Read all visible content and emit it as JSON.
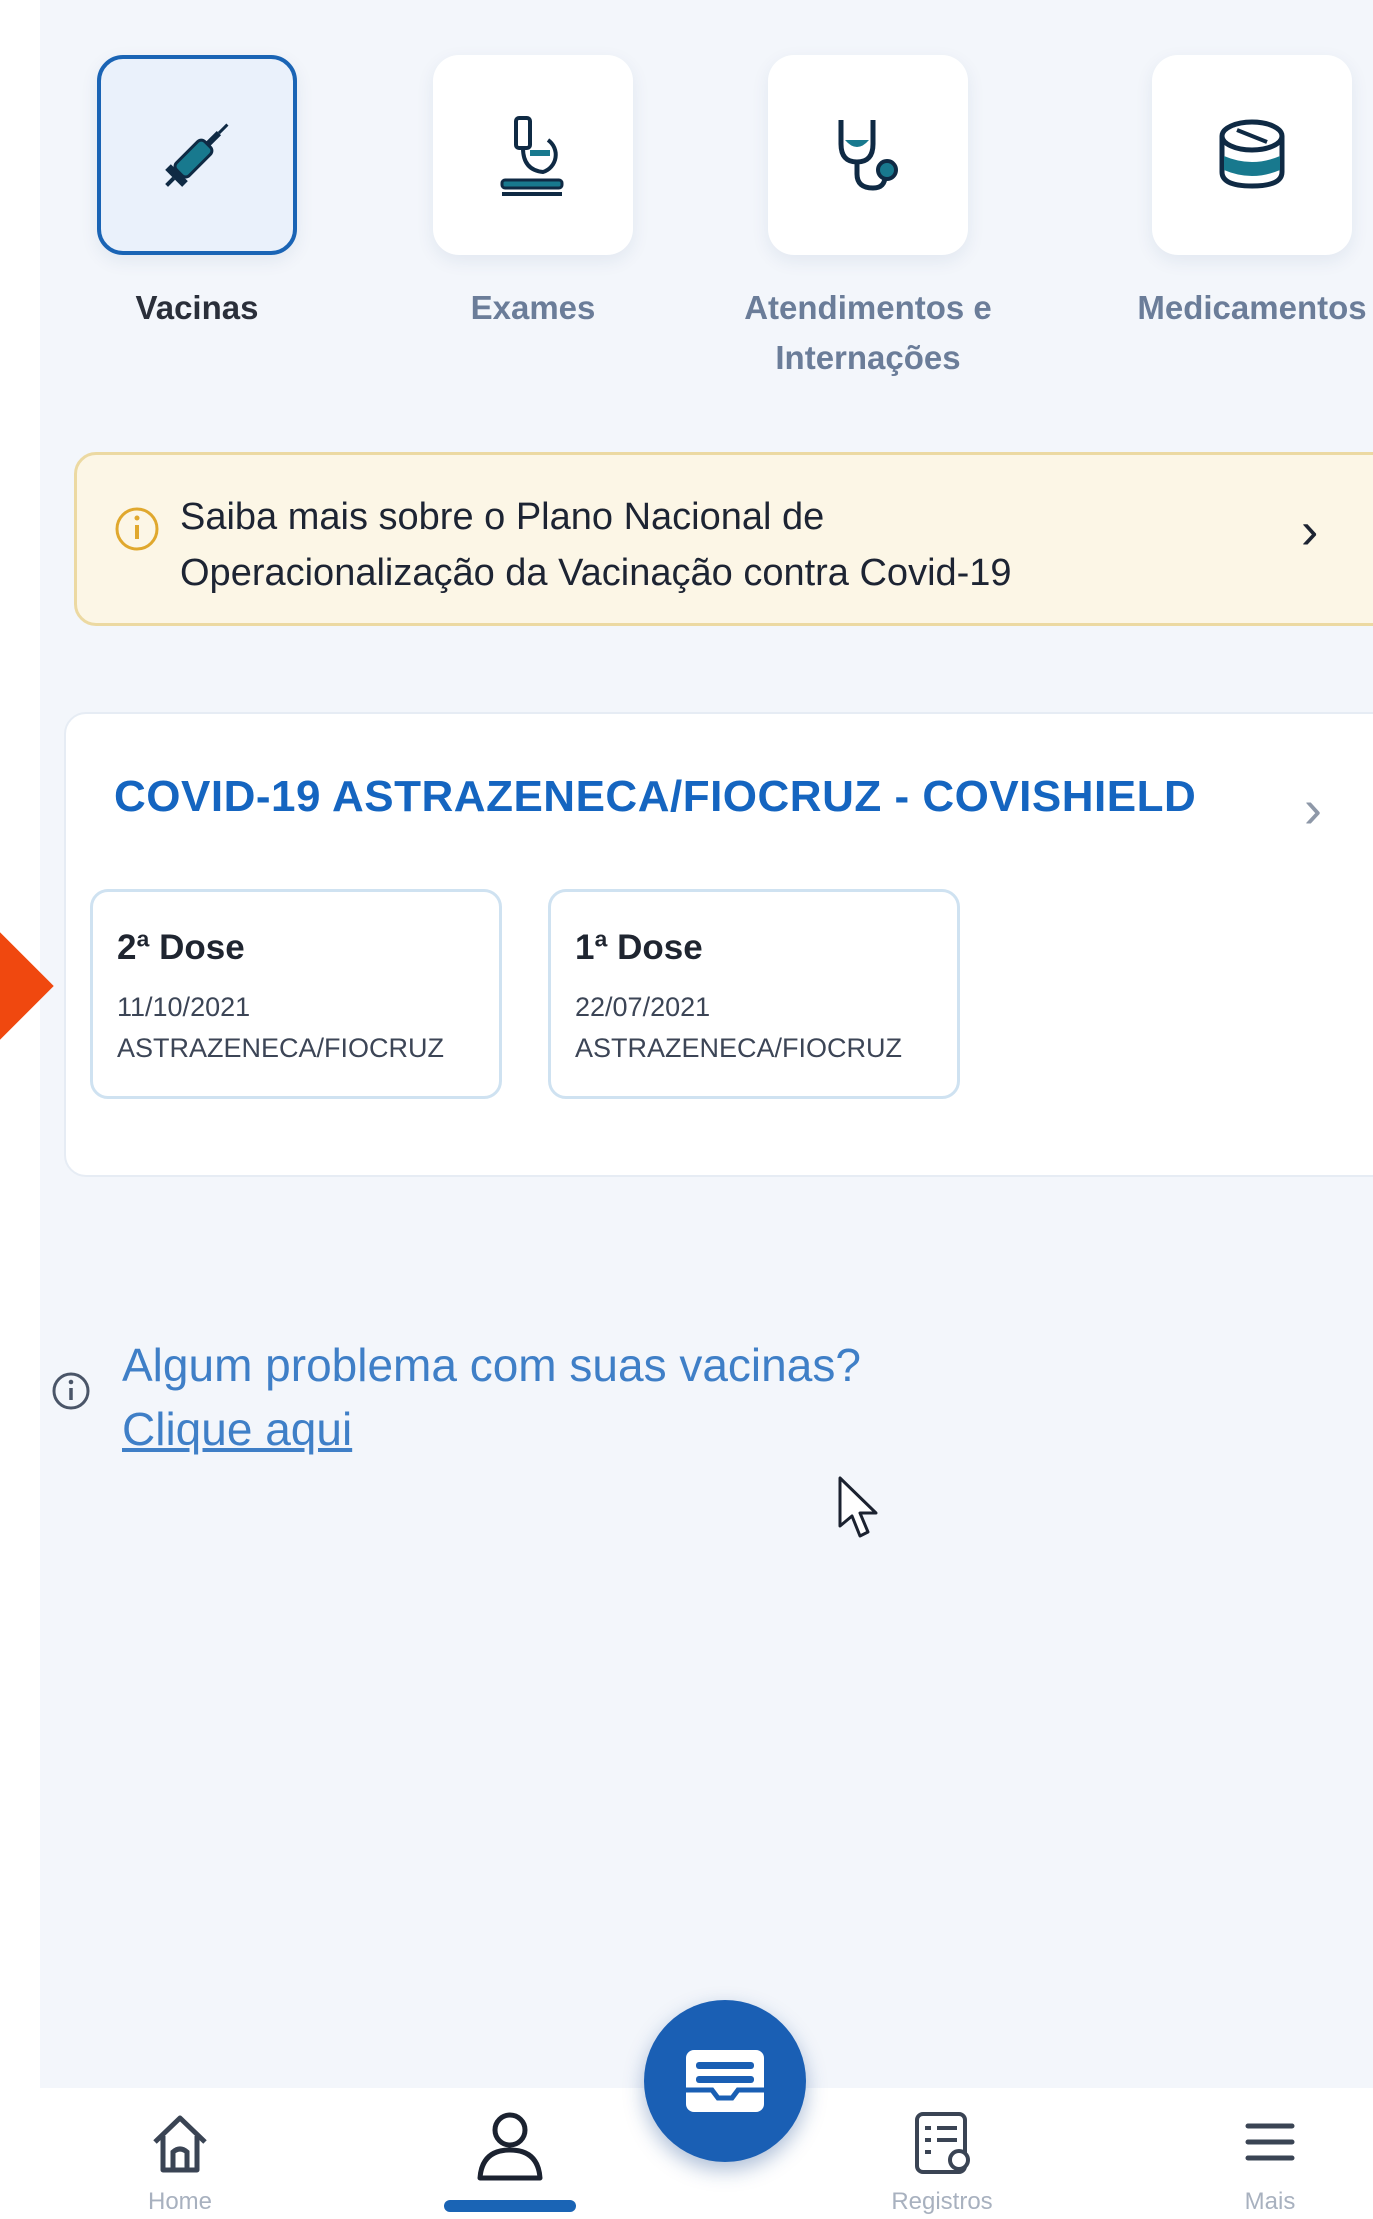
{
  "categories": [
    {
      "label": "Vacinas",
      "icon": "syringe-icon",
      "active": true
    },
    {
      "label": "Exames",
      "icon": "microscope-icon",
      "active": false
    },
    {
      "label": "Atendimentos e Internações",
      "icon": "stethoscope-icon",
      "active": false
    },
    {
      "label": "Medicamentos",
      "icon": "pills-icon",
      "active": false
    }
  ],
  "banner": {
    "line1": "Saiba mais sobre o Plano Nacional de",
    "line2": "Operacionalização da Vacinação contra Covid-19",
    "icon": "info-icon"
  },
  "vaccine": {
    "title": "COVID-19 ASTRAZENECA/FIOCRUZ - COVISHIELD",
    "doses": [
      {
        "label": "2ª Dose",
        "date": "11/10/2021",
        "manufacturer": "ASTRAZENECA/FIOCRUZ"
      },
      {
        "label": "1ª Dose",
        "date": "22/07/2021",
        "manufacturer": "ASTRAZENECA/FIOCRUZ"
      }
    ]
  },
  "help": {
    "question": "Algum problema com suas vacinas?",
    "link": "Clique aqui"
  },
  "tabbar": {
    "items": [
      {
        "label": "Home",
        "icon": "home-icon"
      },
      {
        "label": "",
        "icon": "profile-icon",
        "active": true
      },
      {
        "label": "Registros",
        "icon": "records-icon"
      },
      {
        "label": "Mais",
        "icon": "menu-icon"
      }
    ],
    "fab_icon": "wallet-card-icon"
  },
  "colors": {
    "primary": "#1a64b5",
    "title_blue": "#1565c0",
    "link_blue": "#3f7fc7",
    "banner_bg": "#fcf6e6",
    "banner_border": "#ecd9a2",
    "marker": "#f0480f"
  }
}
